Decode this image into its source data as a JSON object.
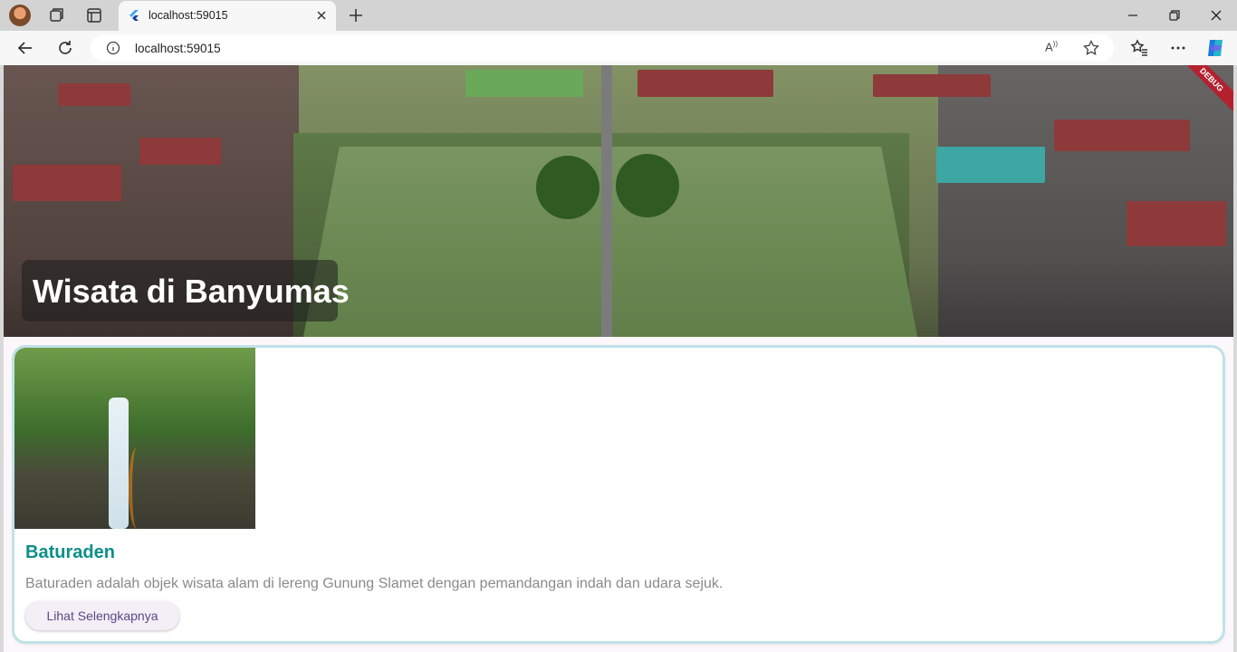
{
  "browser": {
    "tab": {
      "title": "localhost:59015"
    },
    "address_bar": {
      "url": "localhost:59015"
    },
    "read_aloud_label": "A",
    "icons": [
      "profile-avatar-icon",
      "workspaces-icon",
      "tab-actions-icon",
      "flutter-favicon-icon",
      "close-tab-icon",
      "new-tab-icon",
      "minimize-icon",
      "restore-icon",
      "close-window-icon",
      "back-icon",
      "refresh-icon",
      "site-info-icon",
      "read-aloud-icon",
      "favorite-star-icon",
      "favorites-icon",
      "more-icon",
      "copilot-icon"
    ]
  },
  "app": {
    "debug_banner": "DEBUG",
    "hero": {
      "title": "Wisata di Banyumas"
    },
    "destinations": [
      {
        "name": "Baturaden",
        "description": "Baturaden adalah objek wisata alam di lereng Gunung Slamet dengan pemandangan indah dan udara sejuk.",
        "button_label": "Lihat Selengkapnya"
      }
    ]
  },
  "colors": {
    "card_title": "#0d8f8a",
    "card_border": "#bfe2e7",
    "button_bg": "#f4eef7",
    "button_text": "#5a4a84",
    "debug_ribbon": "#b3212f"
  }
}
